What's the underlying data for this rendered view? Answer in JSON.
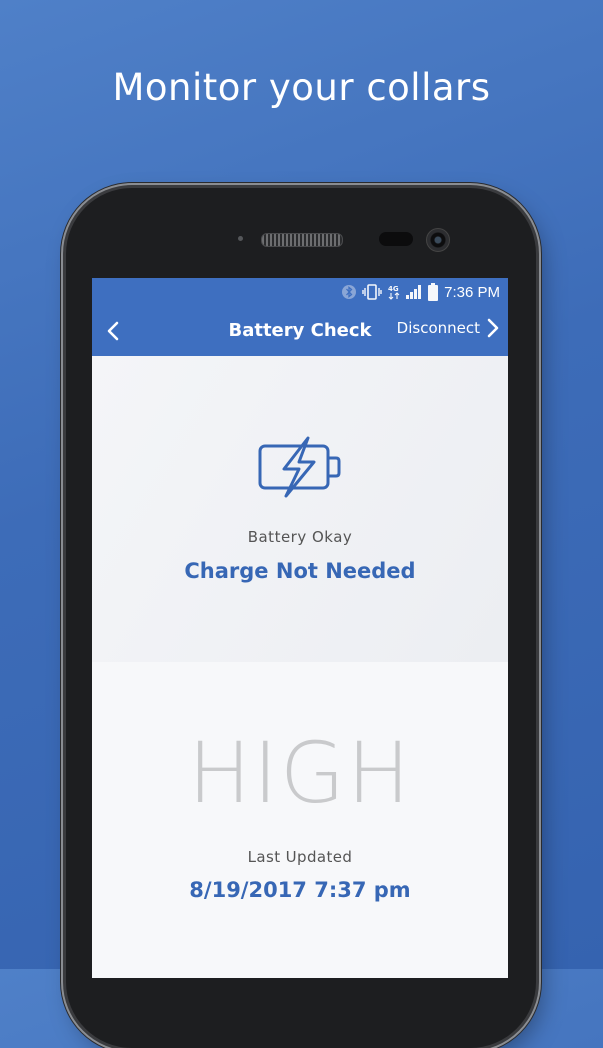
{
  "headline": "Monitor your collars",
  "status_bar": {
    "time": "7:36 PM",
    "icons": [
      "bluetooth-icon",
      "vibrate-icon",
      "4g-lte-icon",
      "signal-icon",
      "battery-icon"
    ],
    "network_label": "4G"
  },
  "nav": {
    "title": "Battery Check",
    "disconnect_label": "Disconnect",
    "back_icon": "chevron-left-icon",
    "forward_icon": "chevron-right-icon"
  },
  "battery_status": {
    "icon": "battery-charging-icon",
    "label": "Battery Okay",
    "value": "Charge Not Needed"
  },
  "battery_level": {
    "value": "HIGH",
    "updated_label": "Last Updated",
    "updated_value": "8/19/2017 7:37 pm"
  },
  "colors": {
    "background": "#3d6cb8",
    "app_bar": "#3e6fc0",
    "accent_text": "#3767b5",
    "level_text": "#c9cacc"
  }
}
